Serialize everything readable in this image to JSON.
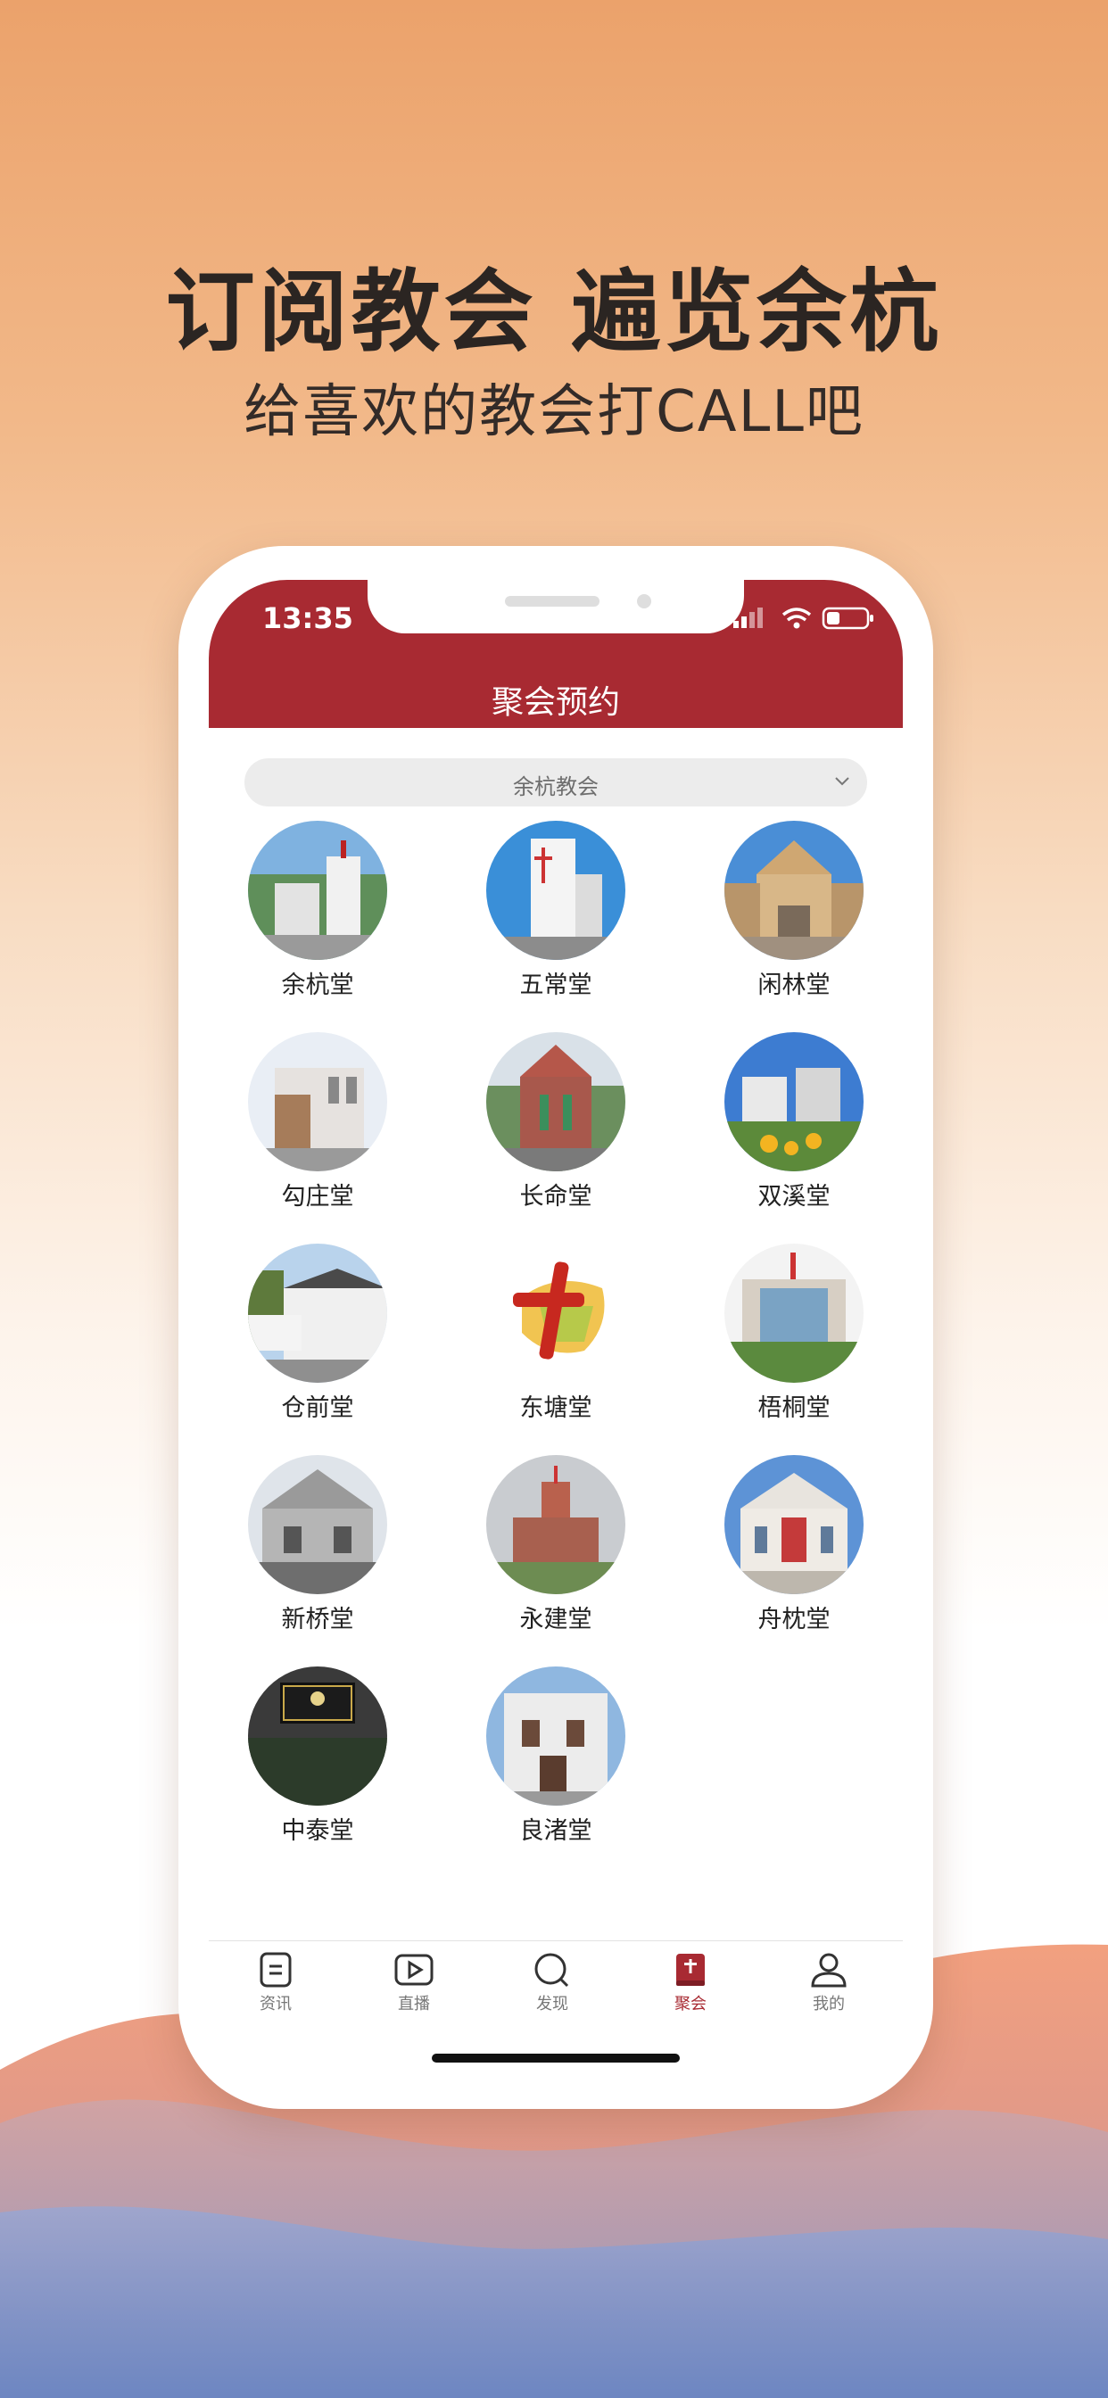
{
  "promo": {
    "headline": "订阅教会  遍览余杭",
    "subline": "给喜欢的教会打CALL吧"
  },
  "status_bar": {
    "time": "13:35"
  },
  "header": {
    "title": "聚会预约"
  },
  "filter": {
    "selected": "余杭教会",
    "icon": "chevron-down-icon"
  },
  "churches": [
    {
      "name": "余杭堂"
    },
    {
      "name": "五常堂"
    },
    {
      "name": "闲林堂"
    },
    {
      "name": "勾庄堂"
    },
    {
      "name": "长命堂"
    },
    {
      "name": "双溪堂"
    },
    {
      "name": "仓前堂"
    },
    {
      "name": "东塘堂"
    },
    {
      "name": "梧桐堂"
    },
    {
      "name": "新桥堂"
    },
    {
      "name": "永建堂"
    },
    {
      "name": "舟枕堂"
    },
    {
      "name": "中泰堂"
    },
    {
      "name": "良渚堂"
    }
  ],
  "tabs": [
    {
      "label": "资讯",
      "icon": "news-icon",
      "active": false
    },
    {
      "label": "直播",
      "icon": "play-icon",
      "active": false
    },
    {
      "label": "发现",
      "icon": "discover-icon",
      "active": false
    },
    {
      "label": "聚会",
      "icon": "gathering-icon",
      "active": true
    },
    {
      "label": "我的",
      "icon": "profile-icon",
      "active": false
    }
  ],
  "colors": {
    "accent": "#a82a32"
  }
}
